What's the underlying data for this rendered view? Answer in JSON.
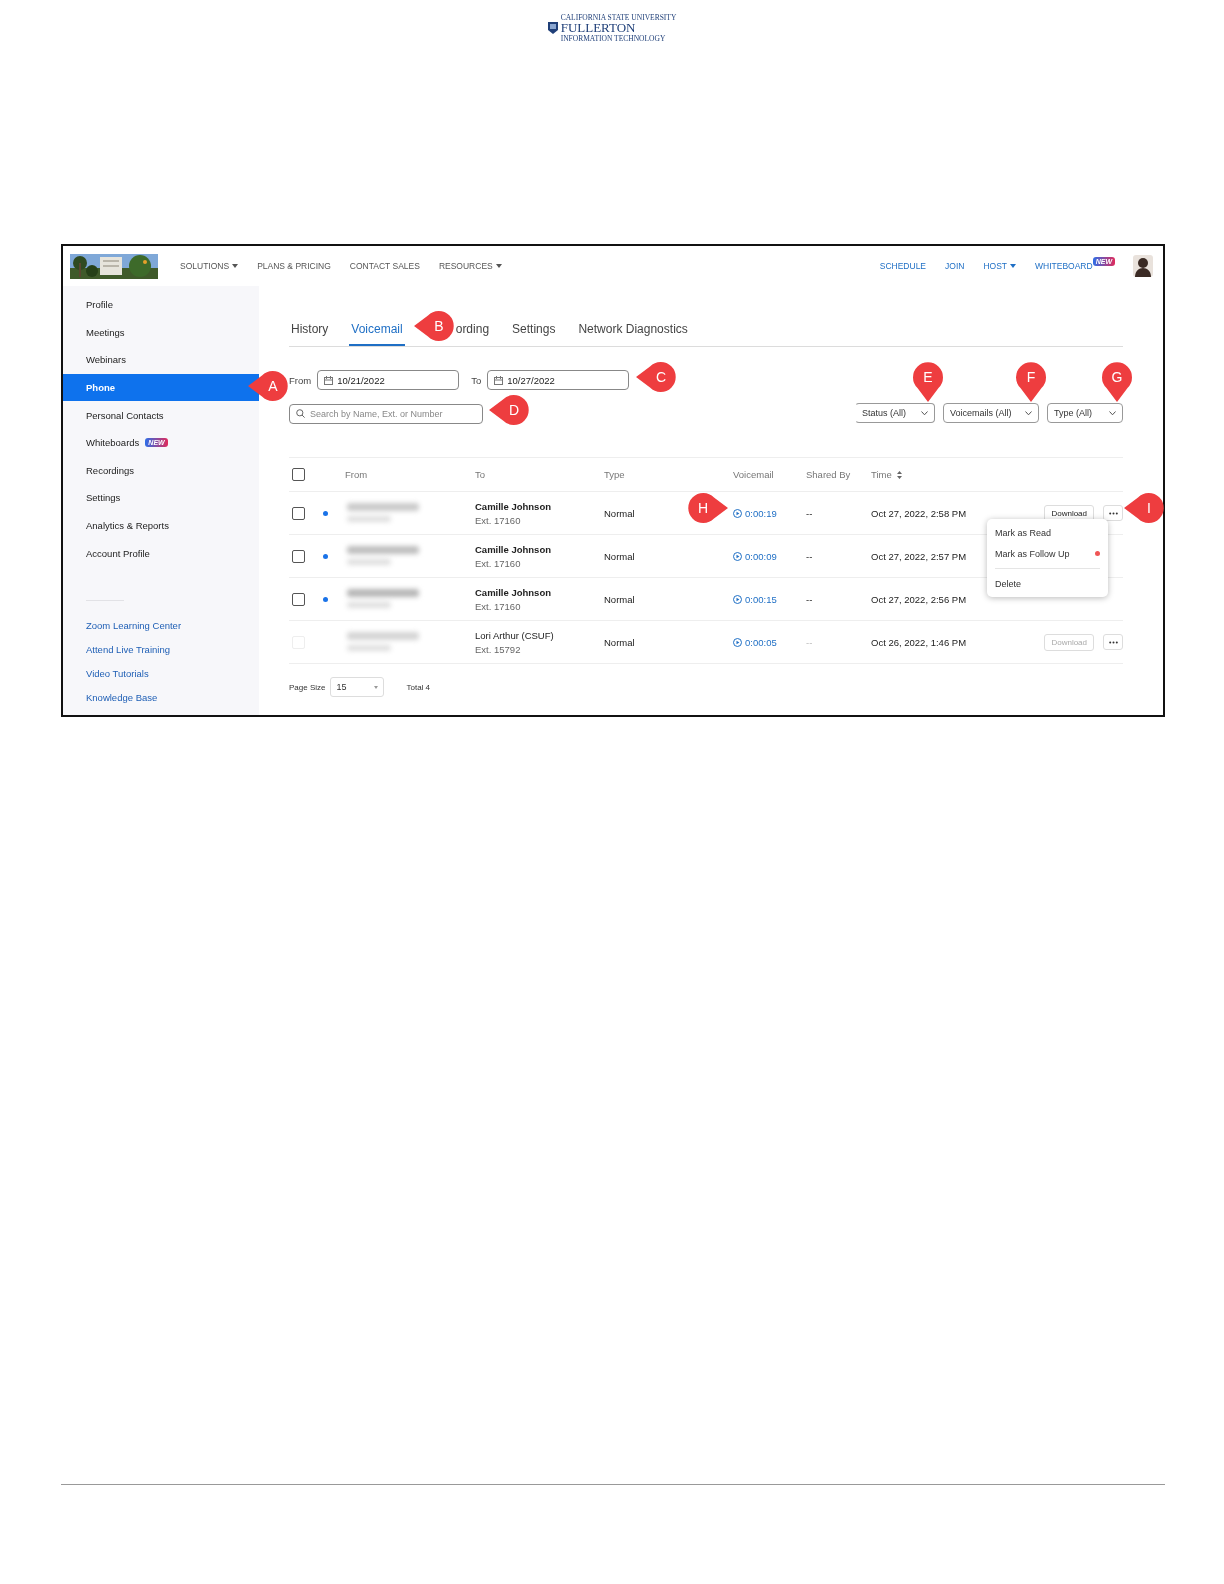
{
  "doc_header": {
    "org_line": "CALIFORNIA STATE UNIVERSITY",
    "name": "FULLERTON",
    "dept": "INFORMATION TECHNOLOGY"
  },
  "nav": {
    "left_items": [
      {
        "label": "SOLUTIONS",
        "dropdown": true
      },
      {
        "label": "PLANS & PRICING",
        "dropdown": false
      },
      {
        "label": "CONTACT SALES",
        "dropdown": false
      },
      {
        "label": "RESOURCES",
        "dropdown": true
      }
    ],
    "right_items": [
      {
        "label": "SCHEDULE",
        "dropdown": false
      },
      {
        "label": "JOIN",
        "dropdown": false
      },
      {
        "label": "HOST",
        "dropdown": true
      },
      {
        "label": "WHITEBOARD",
        "dropdown": false,
        "badge": "NEW"
      }
    ]
  },
  "sidebar": {
    "items": [
      {
        "label": "Profile",
        "selected": false
      },
      {
        "label": "Meetings",
        "selected": false
      },
      {
        "label": "Webinars",
        "selected": false
      },
      {
        "label": "Phone",
        "selected": true
      },
      {
        "label": "Personal Contacts",
        "selected": false
      },
      {
        "label": "Whiteboards",
        "selected": false,
        "badge": "NEW"
      },
      {
        "label": "Recordings",
        "selected": false
      },
      {
        "label": "Settings",
        "selected": false
      },
      {
        "label": "Analytics & Reports",
        "selected": false
      },
      {
        "label": "Account Profile",
        "selected": false
      }
    ],
    "links": [
      "Zoom Learning Center",
      "Attend Live Training",
      "Video Tutorials",
      "Knowledge Base"
    ]
  },
  "tabs": [
    {
      "label": "History",
      "selected": false
    },
    {
      "label": "Voicemail",
      "selected": true
    },
    {
      "label": "ording",
      "selected": false
    },
    {
      "label": "Settings",
      "selected": false
    },
    {
      "label": "Network Diagnostics",
      "selected": false
    }
  ],
  "filters": {
    "from_label": "From",
    "from_value": "10/21/2022",
    "to_label": "To",
    "to_value": "10/27/2022",
    "search_placeholder": "Search by Name, Ext. or Number",
    "dropdowns": [
      "Status (All)",
      "Voicemails (All)",
      "Type (All)"
    ]
  },
  "table": {
    "select_all": {
      "checked": false
    },
    "columns": [
      "From",
      "To",
      "Type",
      "Voicemail",
      "Shared By",
      "Time"
    ],
    "rows": [
      {
        "unread": true,
        "to_name": "Camille Johnson",
        "to_ext": "Ext. 17160",
        "type": "Normal",
        "voicemail": "0:00:19",
        "shared_by": "--",
        "time": "Oct 27, 2022, 2:58 PM",
        "action": "Download"
      },
      {
        "unread": true,
        "to_name": "Camille Johnson",
        "to_ext": "Ext. 17160",
        "type": "Normal",
        "voicemail": "0:00:09",
        "shared_by": "--",
        "time": "Oct 27, 2022, 2:57 PM"
      },
      {
        "unread": true,
        "to_name": "Camille Johnson",
        "to_ext": "Ext. 17160",
        "type": "Normal",
        "voicemail": "0:00:15",
        "shared_by": "--",
        "time": "Oct 27, 2022, 2:56 PM"
      },
      {
        "unread": false,
        "to_name": "Lori Arthur (CSUF)",
        "to_ext": "Ext. 15792",
        "type": "Normal",
        "voicemail": "0:00:05",
        "shared_by": "--",
        "time": "Oct 26, 2022, 1:46 PM",
        "action": "Download"
      }
    ]
  },
  "row_menu": {
    "items": [
      {
        "kind": "item",
        "label": "Mark as Read"
      },
      {
        "kind": "item",
        "label": "Mark as Follow Up",
        "color": "#f05555"
      },
      {
        "kind": "separator"
      },
      {
        "kind": "item",
        "label": "Delete"
      }
    ]
  },
  "pagination": {
    "page_size_label": "Page Size",
    "page_size": "15",
    "total": "Total  4"
  },
  "callouts": [
    {
      "letter": "A"
    },
    {
      "letter": "B"
    },
    {
      "letter": "C"
    },
    {
      "letter": "D"
    },
    {
      "letter": "E"
    },
    {
      "letter": "F"
    },
    {
      "letter": "G"
    },
    {
      "letter": "H"
    },
    {
      "letter": "I"
    }
  ]
}
